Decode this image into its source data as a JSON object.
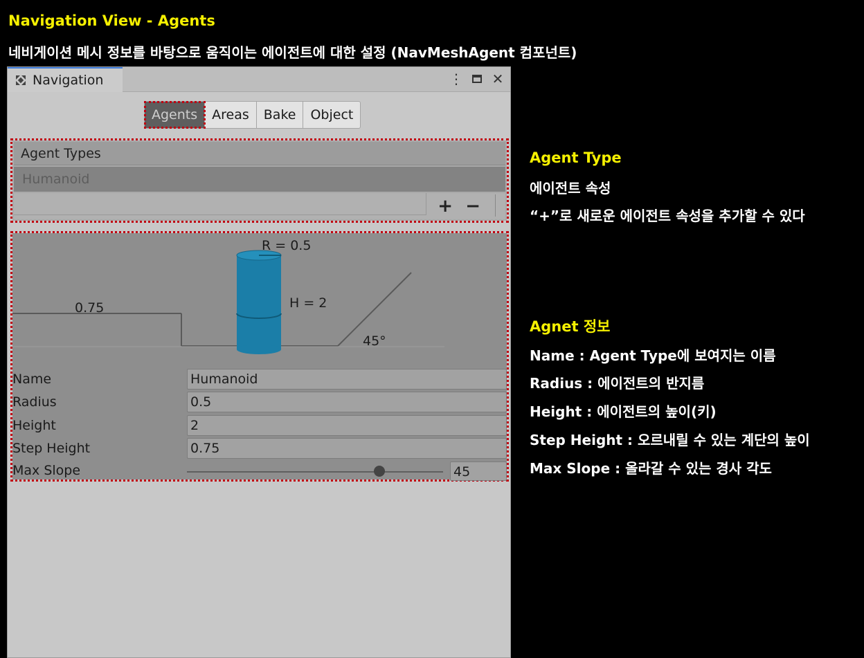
{
  "header": {
    "title": "Navigation View - Agents",
    "subtitle": "네비게이션 메시 정보를 바탕으로 움직이는 에이전트에 대한 설정 (NavMeshAgent 컴포넌트)"
  },
  "window": {
    "tab_label": "Navigation",
    "controls": {
      "menu": "⋮",
      "close": "✕"
    }
  },
  "tabs": [
    "Agents",
    "Areas",
    "Bake",
    "Object"
  ],
  "agent_types": {
    "header": "Agent Types",
    "items": [
      "Humanoid"
    ],
    "add": "+",
    "remove": "−"
  },
  "diagram": {
    "radius_label": "R = 0.5",
    "height_label": "H = 2",
    "step_label": "0.75",
    "slope_label": "45°"
  },
  "agent": {
    "name_label": "Name",
    "name_value": "Humanoid",
    "radius_label": "Radius",
    "radius_value": "0.5",
    "height_label": "Height",
    "height_value": "2",
    "step_height_label": "Step Height",
    "step_height_value": "0.75",
    "max_slope_label": "Max Slope",
    "max_slope_value": "45",
    "max_slope_fraction": 0.75
  },
  "annotations": {
    "agent_type": {
      "heading": "Agent Type",
      "lines": [
        "에이전트 속성",
        "“+”로 새로운 에이전트 속성을 추가할 수 있다"
      ]
    },
    "agent_info": {
      "heading": "Agnet 정보",
      "lines": [
        "Name : Agent Type에 보여지는 이름",
        "Radius : 에이전트의 반지름",
        "Height : 에이전트의 높이(키)",
        "Step Height : 오르내릴 수 있는 계단의 높이",
        "Max Slope : 올라갈 수 있는 경사 각도"
      ]
    }
  },
  "colors": {
    "highlight": "#f5f000",
    "dotted_outline": "#c00010",
    "cylinder": "#1b7ea8",
    "panel_bg": "#c8c8c8"
  }
}
